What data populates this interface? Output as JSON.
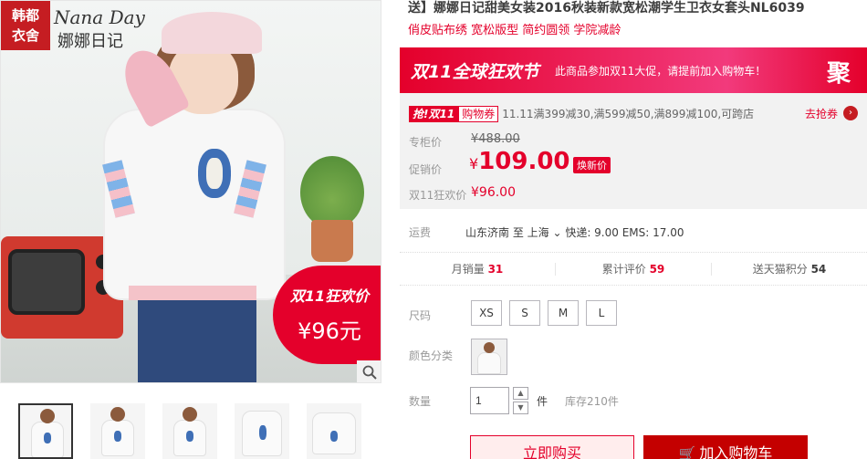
{
  "gallery": {
    "brand_box": "韩都\n衣舍",
    "brand_en": "Nana Day",
    "brand_cn": "娜娜日记",
    "promo_title": "双11狂欢价",
    "promo_price": "¥96元",
    "thumbnail_count": 5
  },
  "product": {
    "title": "送】娜娜日记甜美女装2016秋装新款宽松潮学生卫衣女套头NL6039",
    "subtitle": "俏皮贴布绣 宽松版型 简约圆领 学院减龄"
  },
  "banner": {
    "logo": "双11全球狂欢节",
    "text": "此商品参加双11大促，请提前加入购物车！",
    "ju": "聚"
  },
  "price": {
    "coupon_tag": "抢!双11",
    "coupon_name": "购物券",
    "coupon_desc": "11.11满399减30,满599减50,满899减100,可跨店",
    "coupon_get": "去抢券",
    "orig_label": "专柜价",
    "orig_value": "¥488.00",
    "promo_label": "促销价",
    "promo_currency": "¥",
    "promo_value": "109.00",
    "new_tag": "焕新价",
    "d11_label": "双11狂欢价",
    "d11_value": "¥96.00"
  },
  "shipping": {
    "label": "运费",
    "text": "山东济南  至 上海 ⌄ 快递: 9.00 EMS: 17.00"
  },
  "stats": [
    {
      "label": "月销量",
      "value": "31"
    },
    {
      "label": "累计评价",
      "value": "59"
    },
    {
      "label": "送天猫积分",
      "value": "54"
    }
  ],
  "sku": {
    "size_label": "尺码",
    "sizes": [
      "XS",
      "S",
      "M",
      "L"
    ],
    "color_label": "颜色分类",
    "qty_label": "数量",
    "qty_value": "1",
    "qty_unit": "件",
    "stock": "库存210件"
  },
  "actions": {
    "buy": "立即购买",
    "cart": "加入购物车"
  },
  "colors": {
    "accent": "#e4002b",
    "cart": "#c40000"
  }
}
